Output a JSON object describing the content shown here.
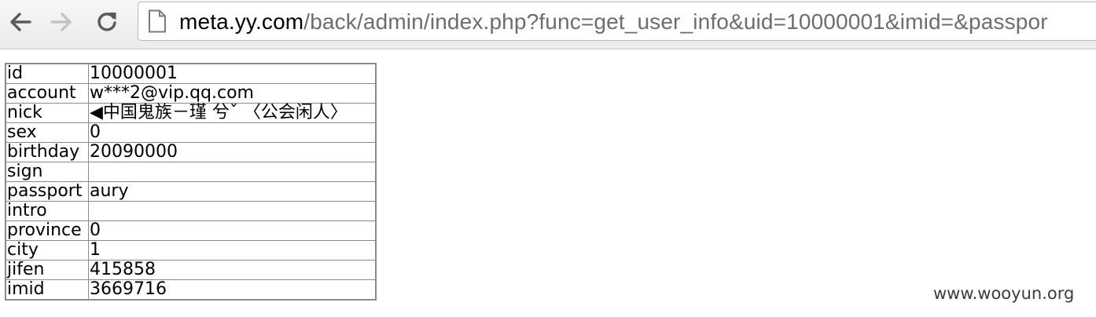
{
  "browser": {
    "url_host": "meta.yy.com",
    "url_path": "/back/admin/index.php?func=get_user_info&uid=10000001&imid=&passpor"
  },
  "user_info": [
    {
      "key": "id",
      "value": "10000001"
    },
    {
      "key": "account",
      "value": "w***2@vip.qq.com"
    },
    {
      "key": "nick",
      "value": "◀中国鬼族－瑾 兮ˇ 〈公会闲人〉"
    },
    {
      "key": "sex",
      "value": "0"
    },
    {
      "key": "birthday",
      "value": "20090000"
    },
    {
      "key": "sign",
      "value": ""
    },
    {
      "key": "passport",
      "value": "aury"
    },
    {
      "key": "intro",
      "value": ""
    },
    {
      "key": "province",
      "value": "0"
    },
    {
      "key": "city",
      "value": "1"
    },
    {
      "key": "jifen",
      "value": "415858"
    },
    {
      "key": "imid",
      "value": "3669716"
    }
  ],
  "watermark": "www.wooyun.org"
}
